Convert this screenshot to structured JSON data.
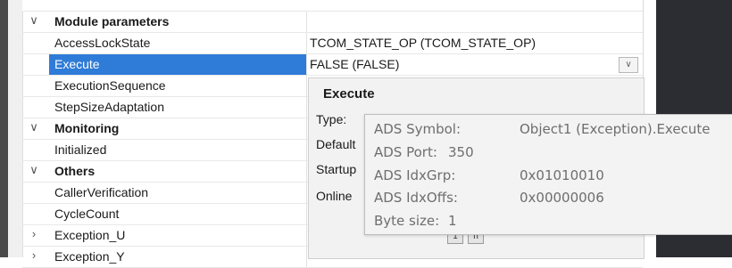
{
  "rows": [
    {
      "kind": "cat",
      "chevron": "expanded",
      "name": "Module parameters",
      "value": ""
    },
    {
      "kind": "item",
      "name": "AccessLockState",
      "value": "TCOM_STATE_OP (TCOM_STATE_OP)"
    },
    {
      "kind": "item",
      "name": "Execute",
      "value": "FALSE (FALSE)",
      "selected": true,
      "dropdown": "chevron-down"
    },
    {
      "kind": "item",
      "name": "ExecutionSequence",
      "value": ""
    },
    {
      "kind": "item",
      "name": "StepSizeAdaptation",
      "value": ""
    },
    {
      "kind": "cat",
      "chevron": "expanded",
      "name": "Monitoring",
      "value": ""
    },
    {
      "kind": "item",
      "name": "Initialized",
      "value": ""
    },
    {
      "kind": "cat",
      "chevron": "expanded",
      "name": "Others",
      "value": ""
    },
    {
      "kind": "item",
      "name": "CallerVerification",
      "value": ""
    },
    {
      "kind": "item",
      "name": "CycleCount",
      "value": ""
    },
    {
      "kind": "item",
      "chevron": "collapsed",
      "name": "Exception_U",
      "value": ""
    },
    {
      "kind": "item",
      "chevron": "collapsed",
      "name": "Exception_Y",
      "value": ""
    }
  ],
  "description": {
    "title": "Execute",
    "labels": [
      "Type:",
      "Default",
      "Startup",
      "Online"
    ],
    "buttons": [
      "1",
      "n"
    ]
  },
  "tooltip": {
    "symbol_label": "ADS Symbol:",
    "symbol_value": "Object1 (Exception).Execute",
    "port_label": "ADS Port:",
    "port_value": "350",
    "idxgrp_label": "ADS IdxGrp:",
    "idxgrp_value": "0x01010010",
    "idxoffs_label": "ADS IdxOffs:",
    "idxoffs_value": "0x00000006",
    "bytesize_label": "Byte size:",
    "bytesize_value": "1"
  }
}
